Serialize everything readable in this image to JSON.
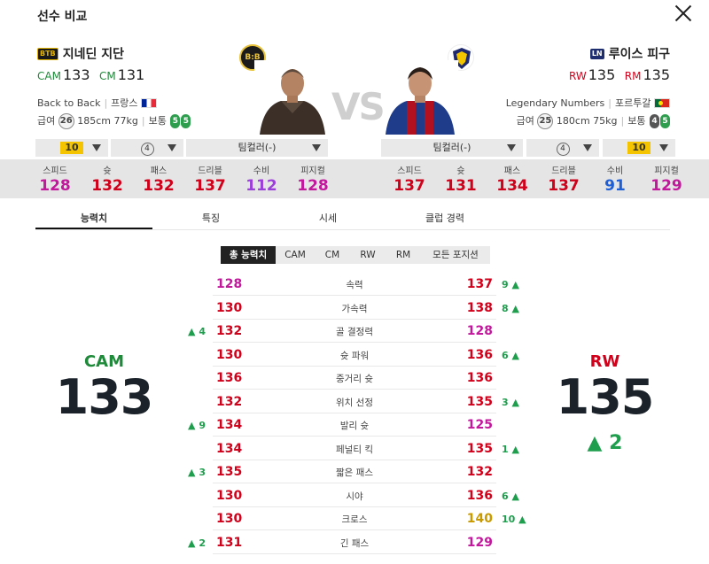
{
  "title": "선수 비교",
  "vs": "VS",
  "left": {
    "season": "BTB",
    "name": "지네딘 지단",
    "pos1": "CAM",
    "ovr1": "133",
    "pos2": "CM",
    "ovr2": "131",
    "season_name": "Back to Back",
    "nation": "프랑스",
    "salary_label": "급여",
    "salary": "26",
    "height": "185cm",
    "weight": "77kg",
    "body": "보통",
    "foot_left": "5",
    "foot_right": "5",
    "level": "10",
    "ability": "4",
    "team_color": "팀컬러(-)",
    "club_logo_text": "B:B"
  },
  "right": {
    "season": "LN",
    "name": "루이스 피구",
    "pos1": "RW",
    "ovr1": "135",
    "pos2": "RM",
    "ovr2": "135",
    "season_name": "Legendary Numbers",
    "nation": "포르투갈",
    "salary_label": "급여",
    "salary": "25",
    "height": "180cm",
    "weight": "75kg",
    "body": "보통",
    "foot_left": "4",
    "foot_right": "5",
    "level": "10",
    "ability": "4",
    "team_color": "팀컬러(-)"
  },
  "stat_labels": [
    "스피드",
    "슛",
    "패스",
    "드리블",
    "수비",
    "피지컬"
  ],
  "left_stats": [
    "128",
    "132",
    "132",
    "137",
    "112",
    "128"
  ],
  "right_stats": [
    "137",
    "131",
    "134",
    "137",
    "91",
    "129"
  ],
  "tabs": [
    "능력치",
    "특징",
    "시세",
    "클럽 경력"
  ],
  "subtabs": [
    "총 능력치",
    "CAM",
    "CM",
    "RW",
    "RM",
    "모든 포지션"
  ],
  "attributes": [
    {
      "name": "속력",
      "left": "128",
      "right": "137",
      "ldiff": "",
      "rdiff": "9 ▲"
    },
    {
      "name": "가속력",
      "left": "130",
      "right": "138",
      "ldiff": "",
      "rdiff": "8 ▲"
    },
    {
      "name": "골 결정력",
      "left": "132",
      "right": "128",
      "ldiff": "▲ 4",
      "rdiff": ""
    },
    {
      "name": "슛 파워",
      "left": "130",
      "right": "136",
      "ldiff": "",
      "rdiff": "6 ▲"
    },
    {
      "name": "중거리 슛",
      "left": "136",
      "right": "136",
      "ldiff": "",
      "rdiff": ""
    },
    {
      "name": "위치 선정",
      "left": "132",
      "right": "135",
      "ldiff": "",
      "rdiff": "3 ▲"
    },
    {
      "name": "발리 슛",
      "left": "134",
      "right": "125",
      "ldiff": "▲ 9",
      "rdiff": ""
    },
    {
      "name": "페널티 킥",
      "left": "134",
      "right": "135",
      "ldiff": "",
      "rdiff": "1 ▲"
    },
    {
      "name": "짧은 패스",
      "left": "135",
      "right": "132",
      "ldiff": "▲ 3",
      "rdiff": ""
    },
    {
      "name": "시야",
      "left": "130",
      "right": "136",
      "ldiff": "",
      "rdiff": "6 ▲"
    },
    {
      "name": "크로스",
      "left": "130",
      "right": "140",
      "ldiff": "",
      "rdiff": "10 ▲"
    },
    {
      "name": "긴 패스",
      "left": "131",
      "right": "129",
      "ldiff": "▲ 2",
      "rdiff": ""
    }
  ],
  "big_left": {
    "pos": "CAM",
    "value": "133"
  },
  "big_right": {
    "pos": "RW",
    "value": "135",
    "diff": "▲ 2"
  },
  "colors": {
    "green": "#1f8a3a",
    "red": "#d0021b",
    "magenta": "#c2189c",
    "purple": "#9b3fd9",
    "blue": "#1f5fd6",
    "gold": "#c89a00",
    "up": "#1f9e4e"
  }
}
